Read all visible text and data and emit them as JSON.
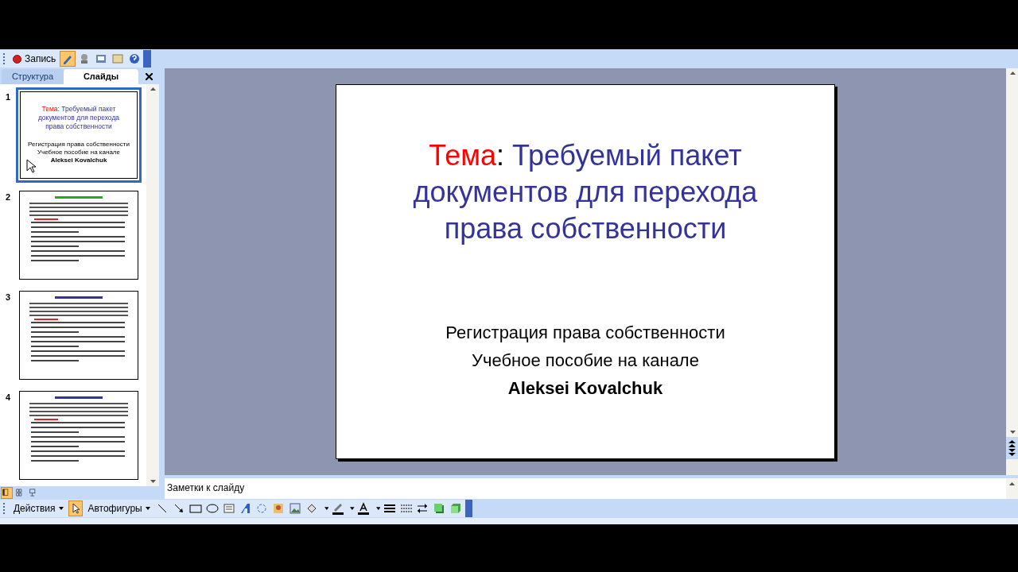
{
  "record_toolbar": {
    "label": "Запись",
    "first_tool_active": true
  },
  "pane": {
    "tabs": [
      {
        "label": "Структура",
        "selected": false
      },
      {
        "label": "Слайды",
        "selected": true
      }
    ],
    "slides": [
      {
        "number": "1",
        "kind": "title",
        "selected": true,
        "title_keyword": "Тема",
        "title_separator": ":",
        "title_rest": "Требуемый пакет документов для перехода права собственности",
        "subtitle_lines": [
          "Регистрация права собственности",
          "Учебное пособие на канале"
        ],
        "author": "Aleksei Kovalchuk"
      },
      {
        "number": "2",
        "kind": "text",
        "selected": false
      },
      {
        "number": "3",
        "kind": "text",
        "selected": false
      },
      {
        "number": "4",
        "kind": "text",
        "selected": false
      }
    ],
    "normal_view_active": true
  },
  "slide": {
    "title_keyword": "Тема",
    "title_separator": ":",
    "title_rest": "Требуемый пакет документов для перехода права собственности",
    "subtitle_lines": [
      "Регистрация права собственности",
      "Учебное пособие на канале"
    ],
    "author": "Aleksei Kovalchuk"
  },
  "notes": {
    "placeholder": "Заметки к слайду"
  },
  "draw_toolbar": {
    "actions_label": "Действия",
    "autoshapes_label": "Автофигуры",
    "select_tool_active": true
  }
}
